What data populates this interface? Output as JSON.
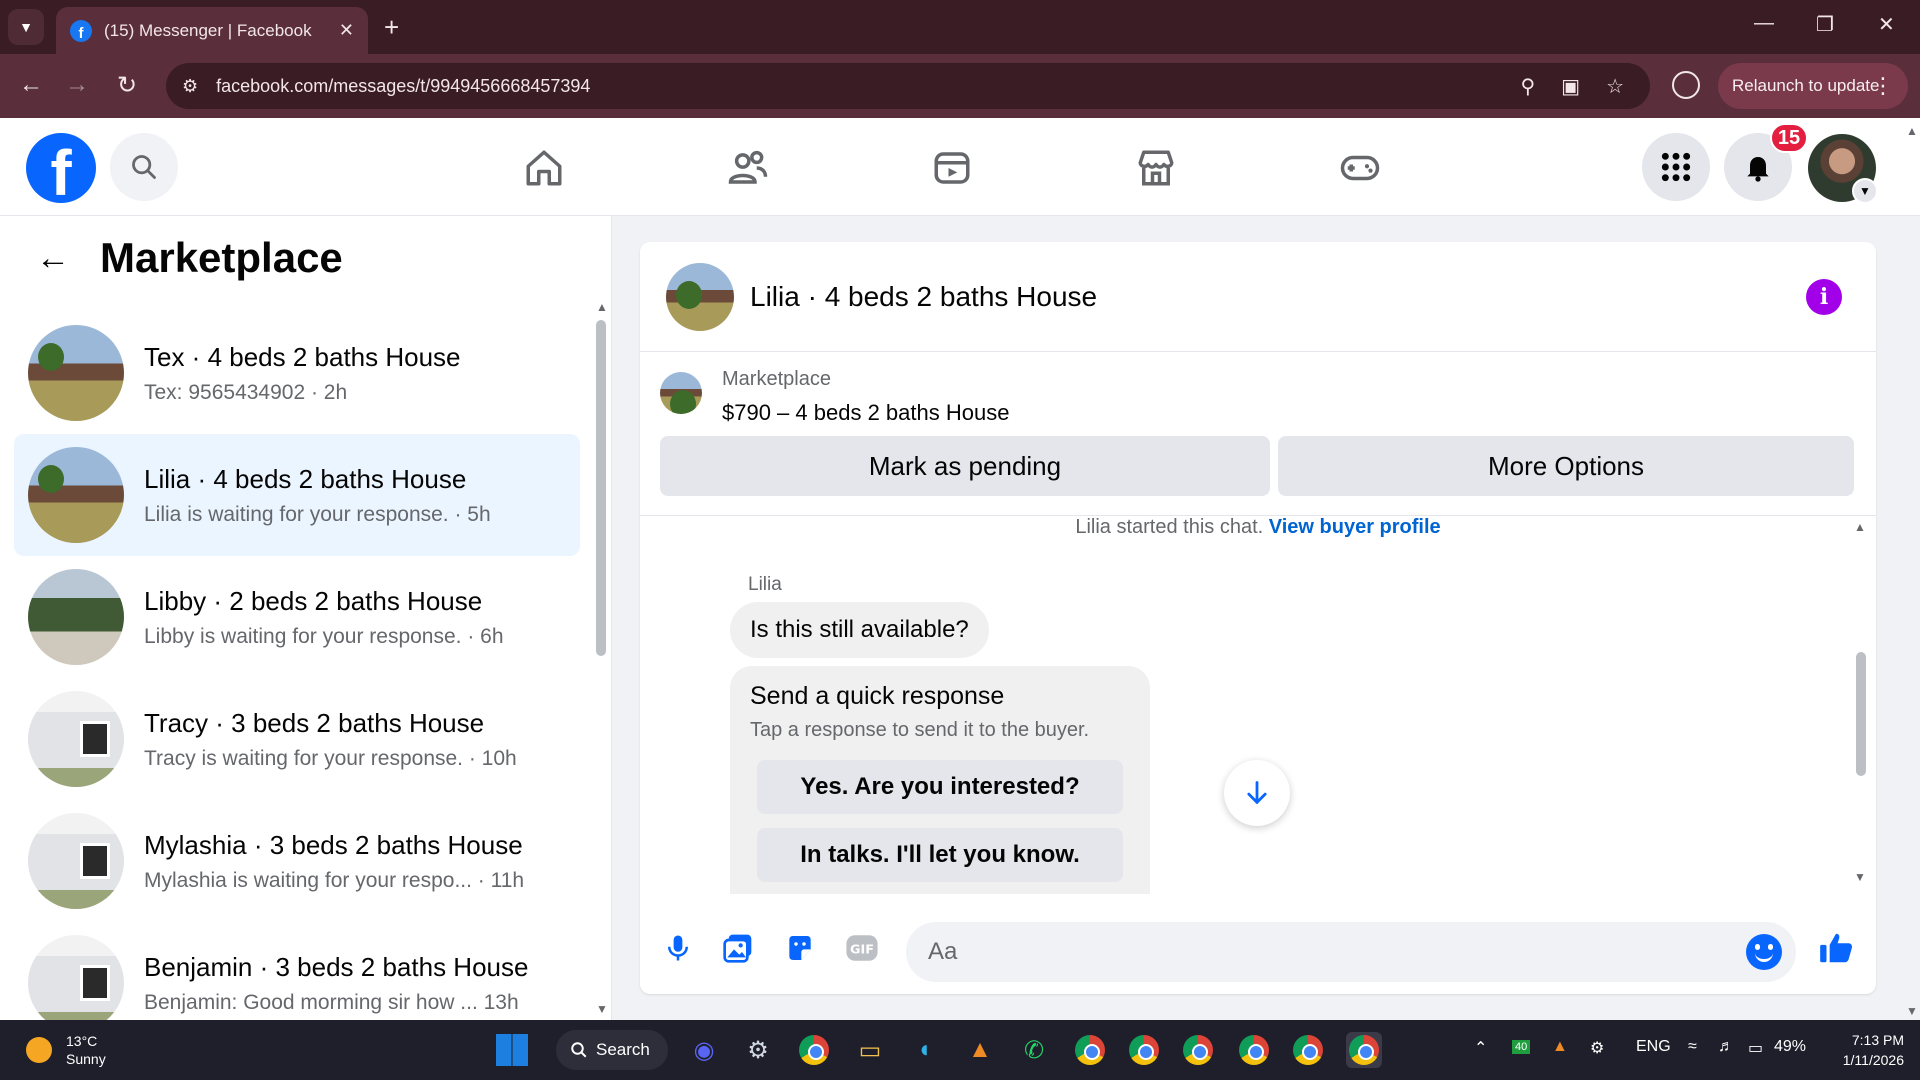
{
  "browser": {
    "tab_title": "(15) Messenger | Facebook",
    "url": "facebook.com/messages/t/9949456668457394",
    "relaunch_label": "Relaunch to update"
  },
  "header": {
    "notification_count": "15"
  },
  "marketplace": {
    "title": "Marketplace",
    "conversations": [
      {
        "name": "Tex · 4 beds 2 baths House",
        "snippet": "Tex: 9565434902 · 2h"
      },
      {
        "name": "Lilia · 4 beds 2 baths House",
        "snippet": "Lilia is waiting for your response. · 5h"
      },
      {
        "name": "Libby · 2 beds 2 baths House",
        "snippet": "Libby is waiting for your response. · 6h"
      },
      {
        "name": "Tracy · 3 beds 2 baths House",
        "snippet": "Tracy is waiting for your response. · 10h"
      },
      {
        "name": "Mylashia · 3 beds 2 baths House",
        "snippet": "Mylashia is waiting for your respo... · 11h"
      },
      {
        "name": "Benjamin · 3 beds 2 baths House",
        "snippet": "Benjamin: Good morming sir how ... 13h"
      }
    ]
  },
  "chat": {
    "title": "Lilia · 4 beds 2 baths House",
    "listing_label": "Marketplace",
    "listing_text": "$790 – 4 beds 2 baths House",
    "mark_pending_label": "Mark as pending",
    "more_options_label": "More Options",
    "started_text": "Lilia started this chat.",
    "view_profile_label": "View buyer profile",
    "sender_name": "Lilia",
    "message_text": "Is this still available?",
    "quick_title": "Send a quick response",
    "quick_subtitle": "Tap a response to send it to the buyer.",
    "quick_responses": [
      "Yes. Are you interested?",
      "In talks. I'll let you know."
    ],
    "input_placeholder": "Aa"
  },
  "taskbar": {
    "temperature": "13°C",
    "weather": "Sunny",
    "search_label": "Search",
    "battery_badge": "40",
    "language": "ENG",
    "battery": "49%",
    "time": "7:13 PM",
    "date": "1/11/2026"
  },
  "colors": {
    "facebook_blue": "#0866ff",
    "active_conversation": "#ebf5ff",
    "link_blue": "#0064d1",
    "info_purple": "#a200e8",
    "badge_red": "#e41e3f",
    "browser_frame": "#5a2f3b"
  }
}
